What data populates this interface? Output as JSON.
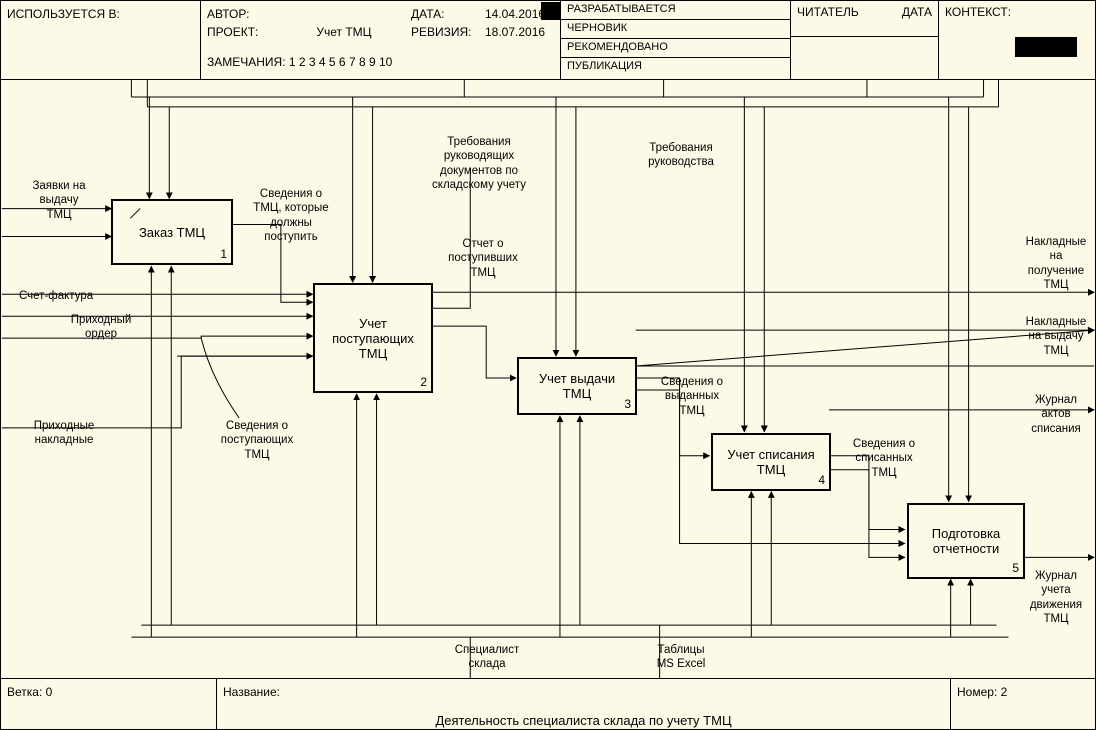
{
  "header": {
    "used_in_label": "ИСПОЛЬЗУЕТСЯ В:",
    "author_label": "АВТОР:",
    "project_label": "ПРОЕКТ:",
    "project_value": "Учет ТМЦ",
    "remarks_label": "ЗАМЕЧАНИЯ:",
    "remarks_value": "1 2 3 4 5 6 7 8 9 10",
    "date_label": "ДАТА:",
    "date_value": "14.04.2016",
    "revision_label": "РЕВИЗИЯ:",
    "revision_value": "18.07.2016",
    "status": {
      "developing": "РАЗРАБАТЫВАЕТСЯ",
      "draft": "ЧЕРНОВИК",
      "recommended": "РЕКОМЕНДОВАНО",
      "publication": "ПУБЛИКАЦИЯ"
    },
    "reader_label": "ЧИТАТЕЛЬ",
    "reader_date_label": "ДАТА",
    "context_label": "КОНТЕКСТ:"
  },
  "boxes": {
    "b1": {
      "title": "Заказ ТМЦ",
      "num": "1"
    },
    "b2": {
      "title": "Учет поступающих ТМЦ",
      "num": "2"
    },
    "b3": {
      "title": "Учет выдачи ТМЦ",
      "num": "3"
    },
    "b4": {
      "title": "Учет списания ТМЦ",
      "num": "4"
    },
    "b5": {
      "title": "Подготовка отчетности",
      "num": "5"
    }
  },
  "labels": {
    "zayavki": "Заявки на\nвыдачу\nТМЦ",
    "schet_faktura": "Счет-фактура",
    "prihodnyy_order": "Приходный\nордер",
    "prihodnye_naklad": "Приходные\nнакладные",
    "svedeniya_tmc_dolzhny": "Сведения о\nТМЦ, которые\nдолжны\nпоступить",
    "svedeniya_postup": "Сведения о\nпоступающих\nТМЦ",
    "trebovaniya_docs": "Требования\nруководящих\nдокументов по\nскладскому учету",
    "trebovaniya_ruk": "Требования\nруководства",
    "otchet_postup": "Отчет о\nпоступивших\nТМЦ",
    "svedeniya_vydannyh": "Сведения о\nвыданных\nТМЦ",
    "svedeniya_spisan": "Сведения о\nсписанных\nТМЦ",
    "specialist": "Специалист\nсклада",
    "tablitsy": "Таблицы\nMS Excel",
    "naklad_poluchenie": "Накладные\nна\nполучение\nТМЦ",
    "naklad_vydachu": "Накладные\nна выдачу\nТМЦ",
    "zhurnal_aktov": "Журнал\nактов\nсписания",
    "zhurnal_ucheta": "Журнал\nучета\nдвижения\nТМЦ"
  },
  "footer": {
    "branch_label": "Ветка:",
    "branch_value": "0",
    "title_label": "Название:",
    "title_value": "Деятельность специалиста склада по учету ТМЦ",
    "number_label": "Номер:",
    "number_value": "2"
  }
}
